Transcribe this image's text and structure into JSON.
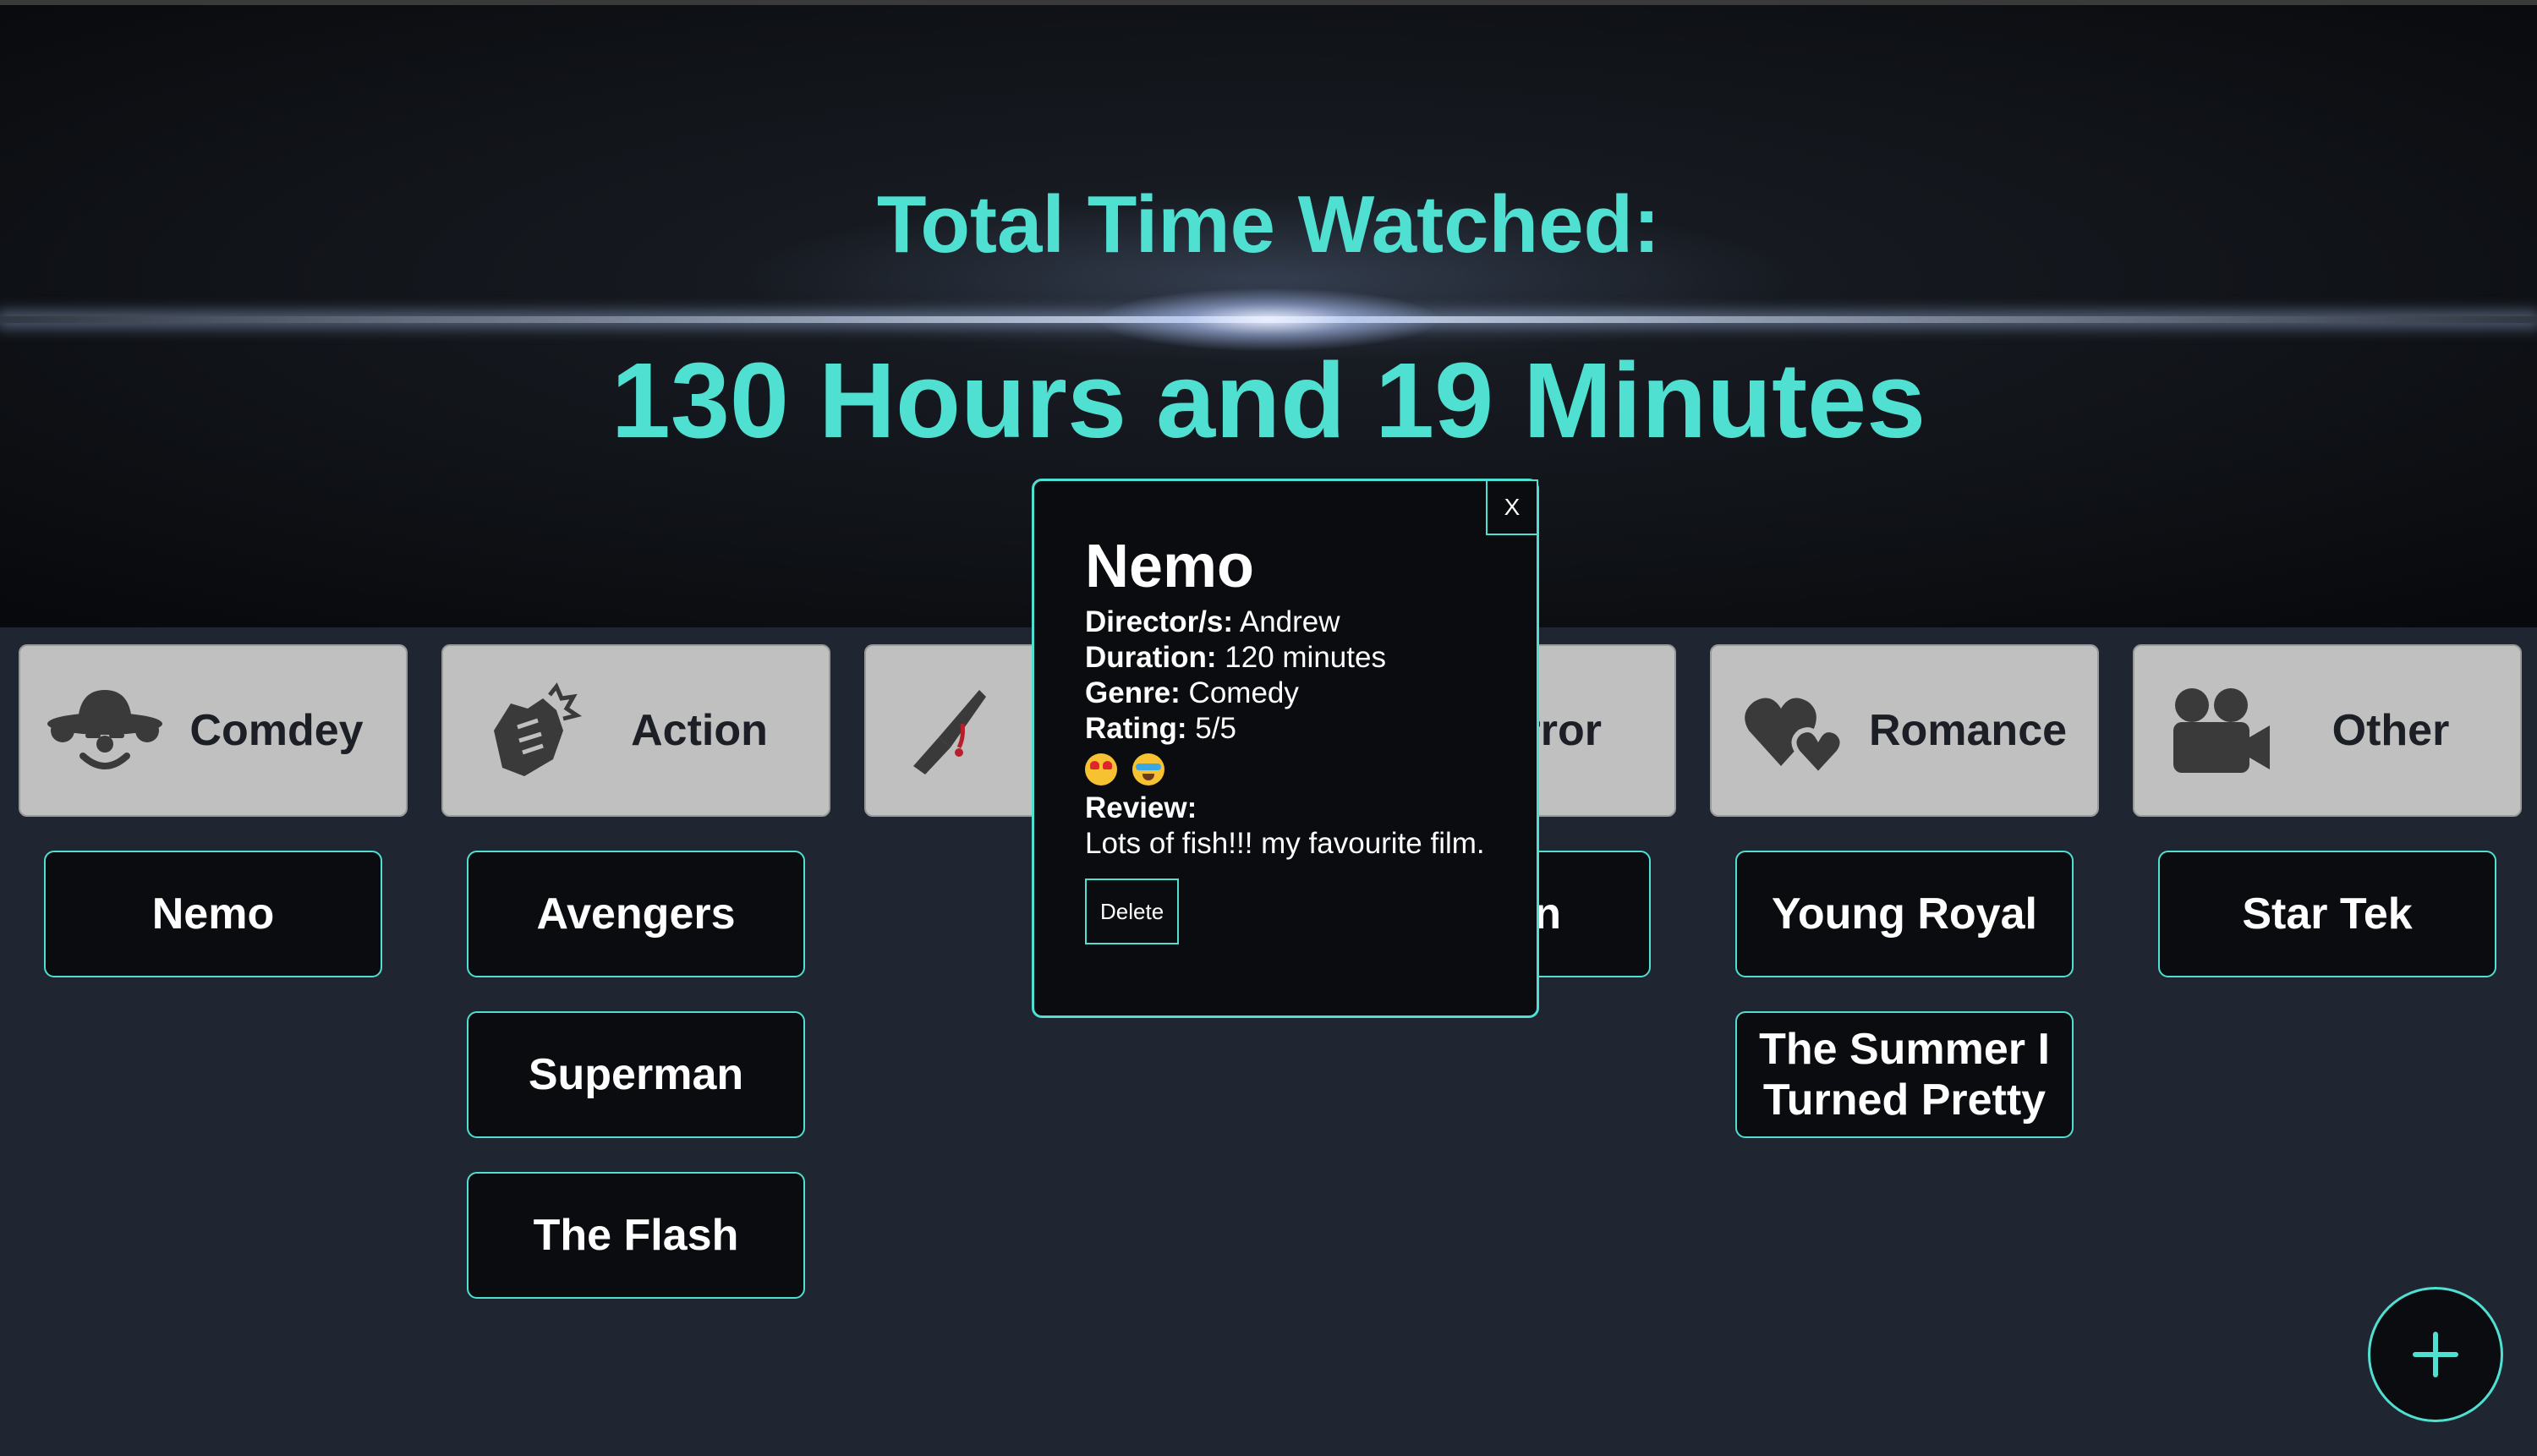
{
  "hero": {
    "title": "Total Time Watched:",
    "total": "130 Hours and 19 Minutes"
  },
  "genres": [
    {
      "label": "Comdey",
      "icon": "clown-icon",
      "films": [
        "Nemo"
      ]
    },
    {
      "label": "Action",
      "icon": "fist-icon",
      "films": [
        "Avengers",
        "Superman",
        "The Flash"
      ]
    },
    {
      "label": "",
      "icon": "knife-icon",
      "films": []
    },
    {
      "label": "rror",
      "icon": "",
      "films": [
        "n"
      ]
    },
    {
      "label": "Romance",
      "icon": "hearts-icon",
      "films": [
        "Young Royal",
        "The Summer I Turned Pretty"
      ]
    },
    {
      "label": "Other",
      "icon": "video-camera-icon",
      "films": [
        "Star Tek"
      ]
    }
  ],
  "modal": {
    "close_label": "X",
    "title": "Nemo",
    "director_label": "Director/s:",
    "director": "Andrew",
    "duration_label": "Duration:",
    "duration": "120 minutes",
    "genre_label": "Genre:",
    "genre": "Comedy",
    "rating_label": "Rating:",
    "rating": "5/5",
    "review_label": "Review:",
    "review": "Lots of fish!!! my favourite film.",
    "delete_label": "Delete"
  },
  "fab": {
    "icon": "plus-icon"
  },
  "colors": {
    "accent": "#4fe0d2",
    "background": "#1f2631",
    "card": "#0b0c10",
    "genre_button": "#c0c0c0"
  }
}
